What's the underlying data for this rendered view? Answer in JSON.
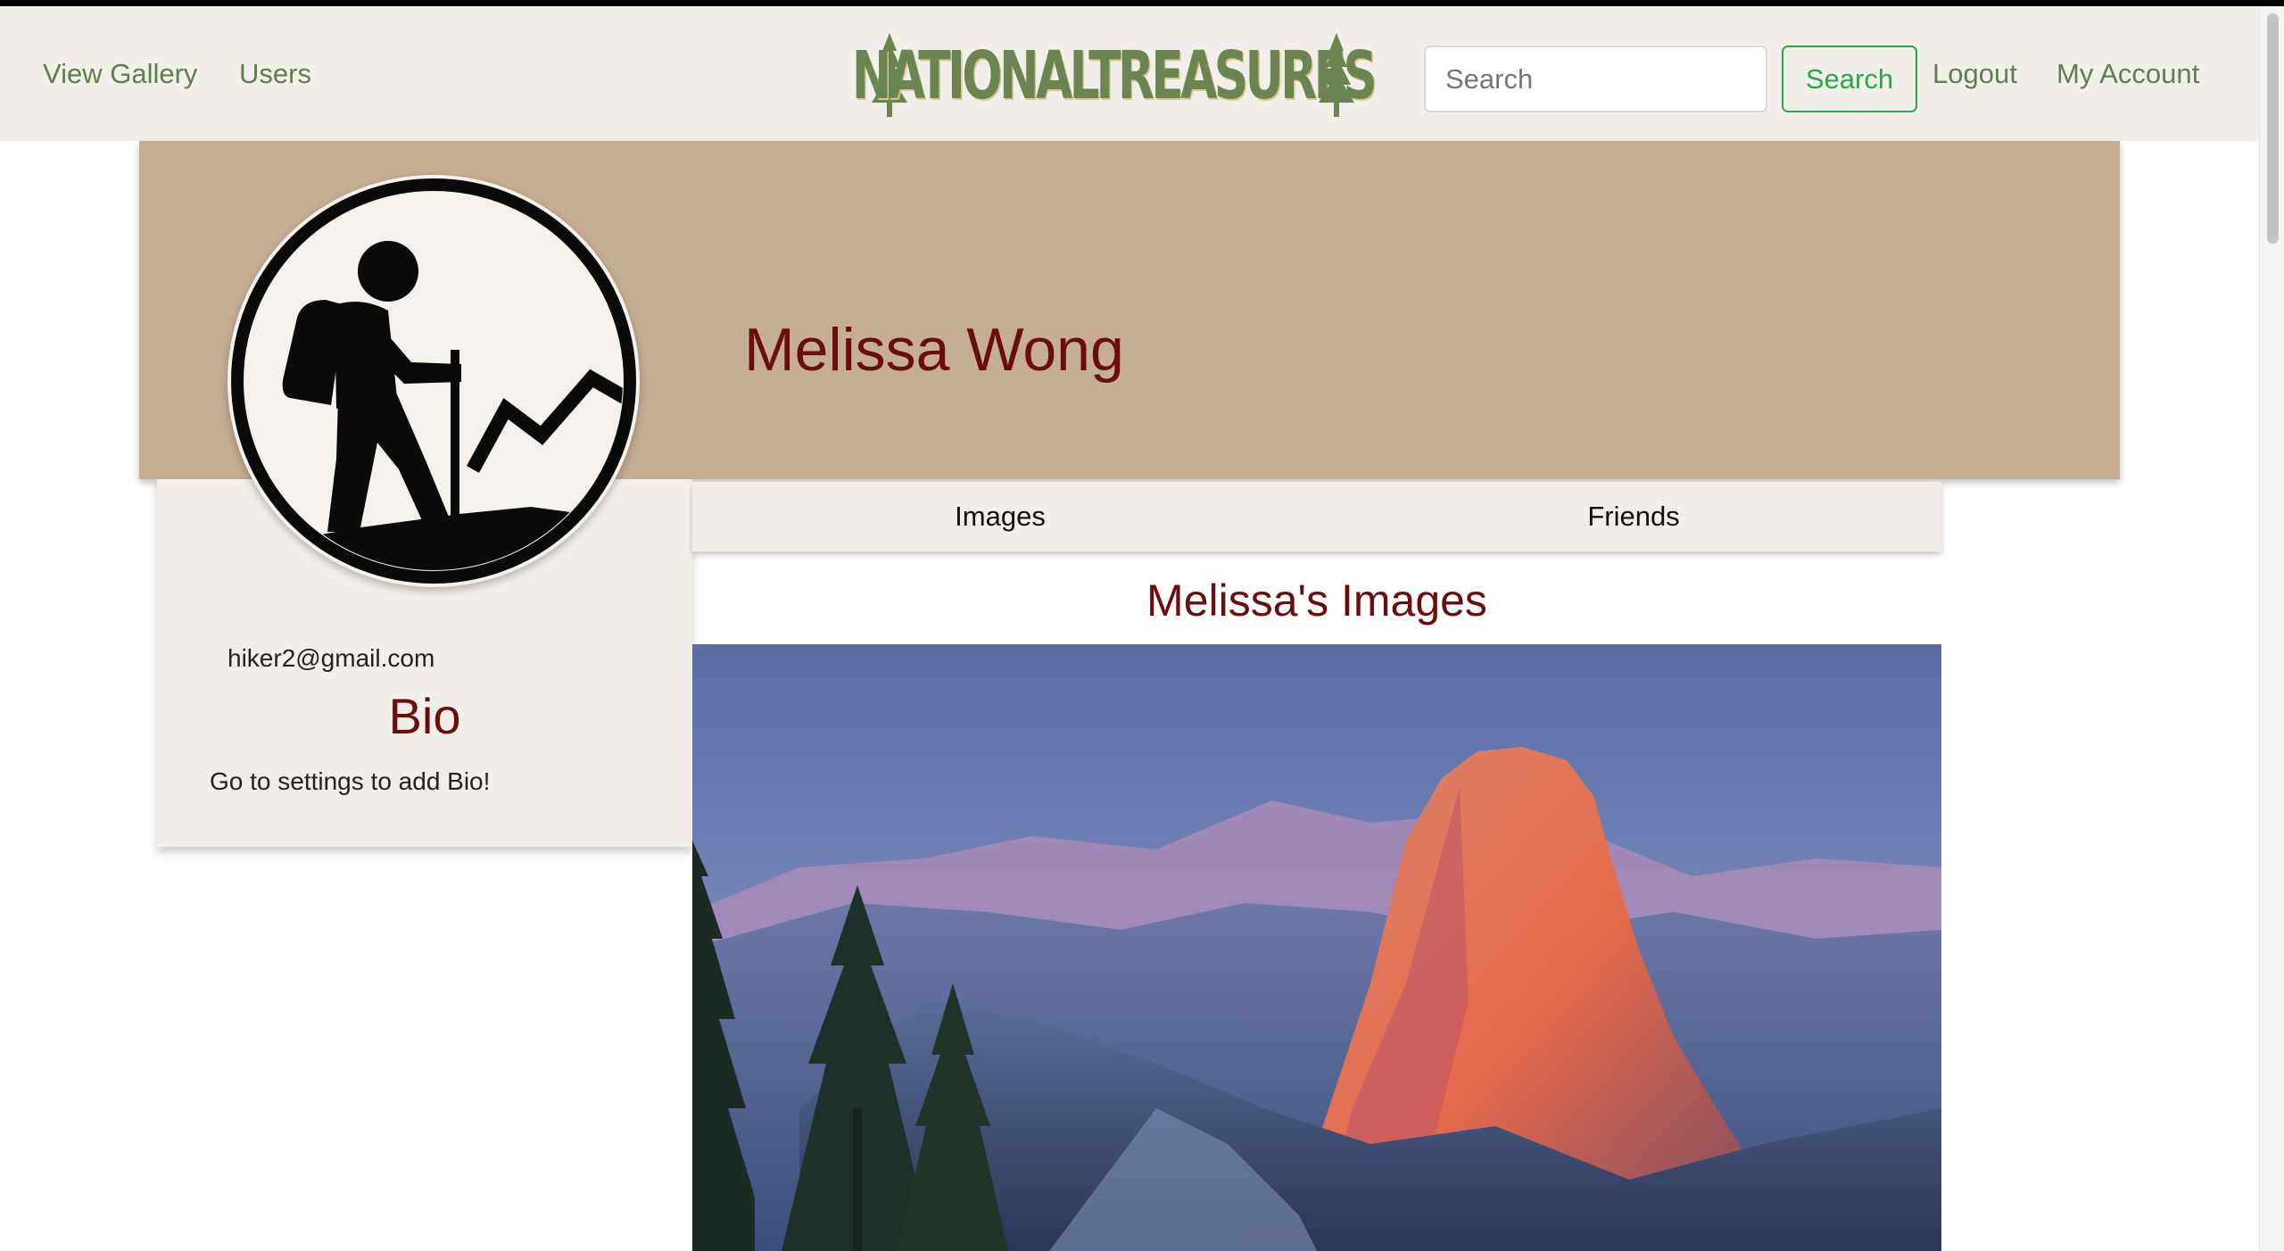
{
  "nav": {
    "left_links": [
      {
        "label": "View Gallery"
      },
      {
        "label": "Users"
      }
    ],
    "logo_text": "NATIONALTREASURES",
    "search_placeholder": "Search",
    "search_button": "Search",
    "logout": "Logout",
    "my_account": "My Account"
  },
  "profile": {
    "name": "Melissa Wong",
    "email": "hiker2@gmail.com",
    "bio_heading": "Bio",
    "bio_text": "Go to settings to add Bio!",
    "avatar_icon": "hiker-icon"
  },
  "tabs": [
    {
      "label": "Images"
    },
    {
      "label": "Friends"
    }
  ],
  "gallery": {
    "heading": "Melissa's Images",
    "image_subject": "mountain-photo"
  },
  "colors": {
    "nav_bg": "#f2eee9",
    "nav_link": "#5e7f4f",
    "banner": "#c6ae93",
    "heading": "#6b0d0d",
    "search_green": "#28a745"
  }
}
